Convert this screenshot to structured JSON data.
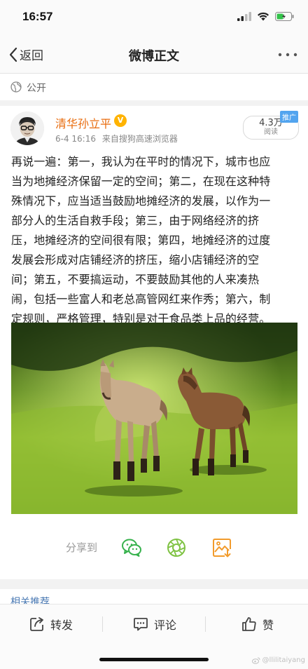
{
  "status_bar": {
    "time": "16:57"
  },
  "nav": {
    "back_label": "返回",
    "title": "微博正文"
  },
  "visibility": {
    "label": "公开"
  },
  "post": {
    "author": "清华孙立平",
    "date": "6-4 16:16",
    "source": "来自搜狗高速浏览器",
    "read_count": "4.3万",
    "read_label": "阅读",
    "promo_tag": "推广",
    "lines": [
      "再说一遍：第一，我认为在平时的情况下，城市也应",
      "当为地摊经济保留一定的空间；第二，在现在这种特",
      "殊情况下，应当适当鼓励地摊经济的发展，以作为一",
      "部分人的生活自救手段；第三，由于网络经济的挤",
      "压，地摊经济的空间很有限；第四，地摊经济的过度",
      "发展会形成对店铺经济的挤压，缩小店铺经济的空",
      "间；第五，不要搞运动，不要鼓励其他的人来凑热",
      "闹，包括一些富人和老总高管网红来作秀；第六，制",
      "定规则，严格管理，特别是对于食品类上品的经营。"
    ]
  },
  "share": {
    "label": "分享到"
  },
  "related": {
    "title": "相关推荐"
  },
  "actions": {
    "repost": "转发",
    "comment": "评论",
    "like": "赞"
  },
  "watermark": {
    "text": "@llilitaiyang"
  },
  "colors": {
    "author": "#e86b0c",
    "link": "#4a79b3",
    "wechat": "#37b24d",
    "moments": "#7ec242",
    "save": "#f29b2c"
  }
}
